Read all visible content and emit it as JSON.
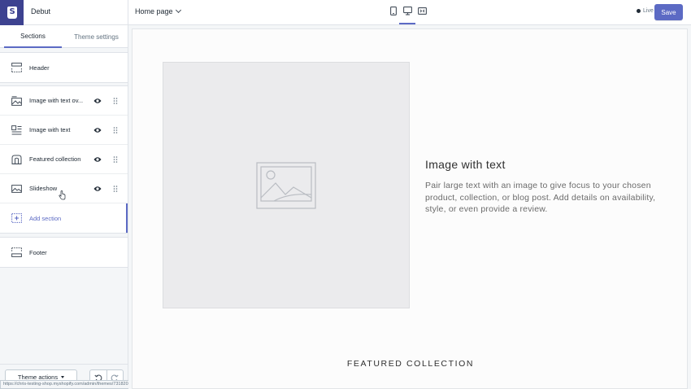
{
  "topbar": {
    "theme_name": "Debut",
    "page_select": "Home page",
    "live_label": "Live",
    "save_label": "Save",
    "devices": [
      "mobile-icon",
      "desktop-icon",
      "fullscreen-icon"
    ],
    "active_device": "desktop-icon"
  },
  "sidebar": {
    "tabs": [
      {
        "label": "Sections",
        "active": true
      },
      {
        "label": "Theme settings",
        "active": false
      }
    ],
    "header_item": {
      "label": "Header",
      "icon": "header-icon"
    },
    "items": [
      {
        "label": "Image with text ov...",
        "icon": "image-overlay-icon"
      },
      {
        "label": "Image with text",
        "icon": "image-text-icon"
      },
      {
        "label": "Featured collection",
        "icon": "collection-icon"
      },
      {
        "label": "Slideshow",
        "icon": "slideshow-icon"
      }
    ],
    "add_section_label": "Add section",
    "footer_item": {
      "label": "Footer",
      "icon": "footer-icon"
    },
    "theme_actions_label": "Theme actions",
    "status_url": "https://chris-testing-shop.myshopify.com/admin/themes/73182052400/editor#"
  },
  "preview": {
    "heading": "Image with text",
    "body": "Pair large text with an image to give focus to your chosen product, collection, or blog post. Add details on availability, style, or even provide a review.",
    "featured_heading": "FEATURED COLLECTION"
  },
  "colors": {
    "accent": "#5c6ac4",
    "logo_bg": "#3d4290"
  }
}
